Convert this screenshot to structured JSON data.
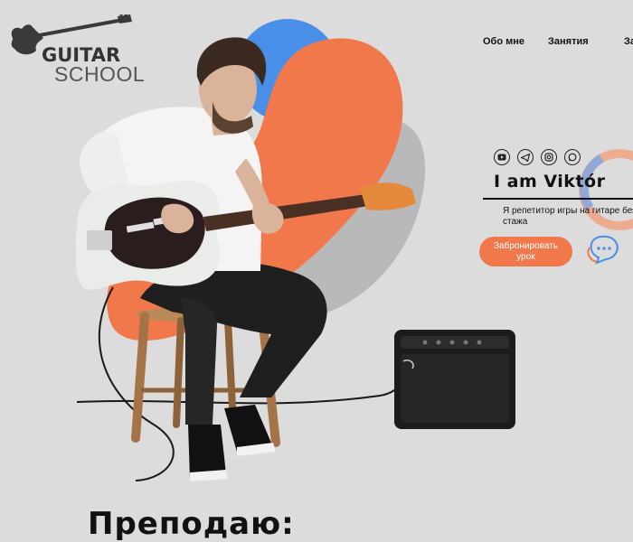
{
  "logo": {
    "word1": "GUITAR",
    "word2": "SCHOOL"
  },
  "nav": {
    "items": [
      "Обо мне",
      "Занятия",
      "Записаться"
    ]
  },
  "social": {
    "icons": [
      "youtube-icon",
      "telegram-icon",
      "instagram-icon",
      "whatsapp-icon"
    ]
  },
  "hero": {
    "name": "I am Viktór",
    "subtitle": "Я репетитор игры на гитаре без стажа",
    "book_button": "Забронировать урок"
  },
  "section": {
    "heading": "Преподаю:"
  },
  "colors": {
    "orange": "#f1784a",
    "blue": "#4a8fe7",
    "gray_blob": "#b9b9b9",
    "background": "#dcdcdc"
  }
}
